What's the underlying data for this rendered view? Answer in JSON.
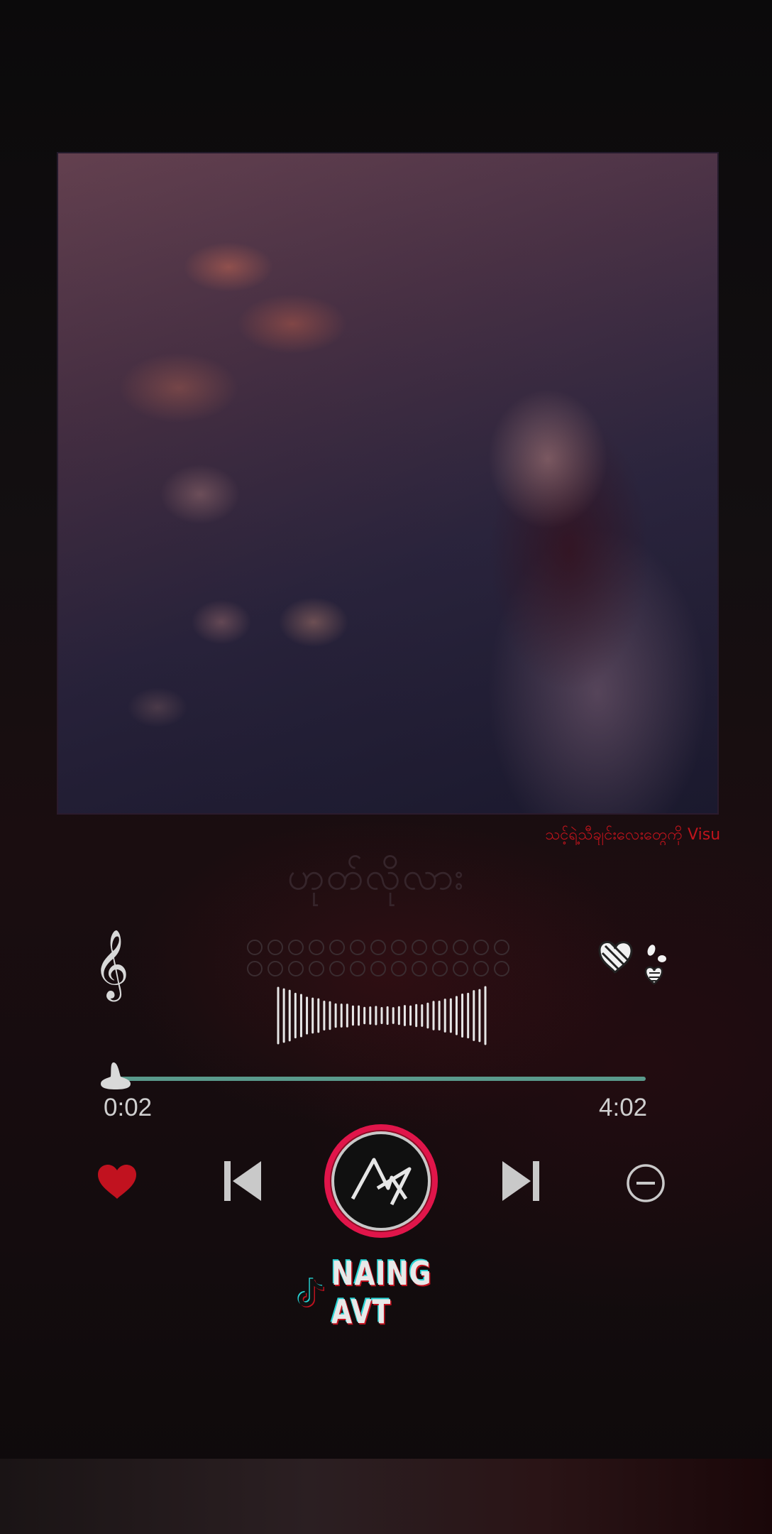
{
  "album_art": {
    "description_icon": "album-cover-image"
  },
  "marquee_text": "သင့်ရဲ့သီချင်းလေးတွေကို Visu",
  "song_title_script": "ဟုတ်လိုလား",
  "icons": {
    "clef": "𝄞",
    "hearts": "hearts-doodle-icon"
  },
  "player": {
    "current_time": "0:02",
    "total_time": "4:02",
    "progress": 0.008
  },
  "controls": {
    "favorite": "heart-icon",
    "previous": "skip-previous-icon",
    "play": "play-pause-logo-button",
    "next": "skip-next-icon",
    "minus": "minus-circle-icon"
  },
  "brand": {
    "text": "NAING AVT"
  },
  "colors": {
    "accent_red": "#c1121f",
    "progress_teal": "#5a9a8c",
    "ring_pink": "#e0154a"
  }
}
